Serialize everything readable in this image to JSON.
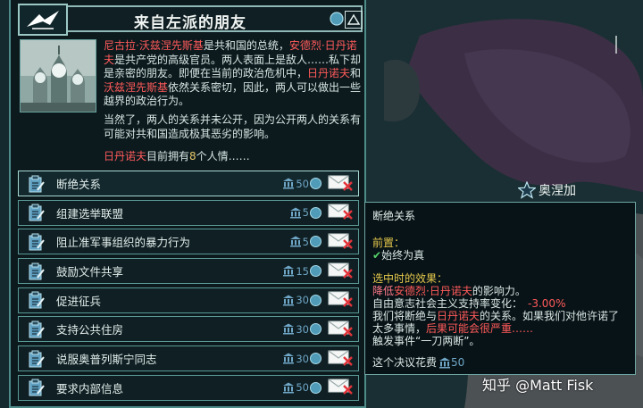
{
  "title": "来自左派的朋友",
  "description": {
    "p1_name1": "尼古拉·沃兹涅先斯基",
    "p1_t1": "是共和国的总统，",
    "p1_name2": "安德烈·日丹诺夫",
    "p1_t2": "是共产党的高级官员。两人表面上是敌人……私下却是亲密的朋友。即便在当前的政治危机中，",
    "p1_name3": "日丹诺夫",
    "p1_t3": "和",
    "p1_name4": "沃兹涅先斯基",
    "p1_t4": "依然关系密切，因此，两人可以做出一些越界的政治行为。",
    "p2": "当然了，两人的关系并未公开，因为公开两人的关系有可能对共和国造成极其恶劣的影响。",
    "favor_name": "日丹诺夫",
    "favor_t1": "目前拥有",
    "favor_count": "8",
    "favor_t2": "个人情……"
  },
  "decisions": [
    {
      "label": "断绝关系",
      "cost": "50"
    },
    {
      "label": "组建选举联盟",
      "cost": "5"
    },
    {
      "label": "阻止准军事组织的暴力行为",
      "cost": "5"
    },
    {
      "label": "鼓励文件共享",
      "cost": "15"
    },
    {
      "label": "促进征兵",
      "cost": "30"
    },
    {
      "label": "支持公共住房",
      "cost": "30"
    },
    {
      "label": "说服奥普列斯宁同志",
      "cost": "30"
    },
    {
      "label": "要求内部信息",
      "cost": "50"
    }
  ],
  "tooltip": {
    "title": "断绝关系",
    "prereq_label": "前置：",
    "prereq_value": "始终为真",
    "effect_label": "选中时的效果：",
    "effect1_pre": "降低",
    "effect1_name": "安德烈·日丹诺夫",
    "effect1_post": "的影响力。",
    "effect2_label": "自由意志社会主义支持率变化：",
    "effect2_value": "-3.00%",
    "effect3_pre": "我们将断绝与",
    "effect3_name": "日丹诺夫",
    "effect3_post": "的关系。如果我们对他许诺了",
    "effect4_pre": "太多事情，",
    "effect4_warn": "后果可能会很严重……",
    "effect5": "触发事件“一刀两断”。",
    "cost_pre": "这个决议花费",
    "cost_value": "50"
  },
  "map_label": "奥涅加",
  "watermark": "知乎 @Matt Fisk",
  "colors": {
    "panel_border": "#4e8c8a",
    "highlight_red": "#ff5a5a",
    "cost_blue": "#6fa6c6",
    "positive_green": "#56d46a",
    "header_yellow": "#e6c94c"
  }
}
